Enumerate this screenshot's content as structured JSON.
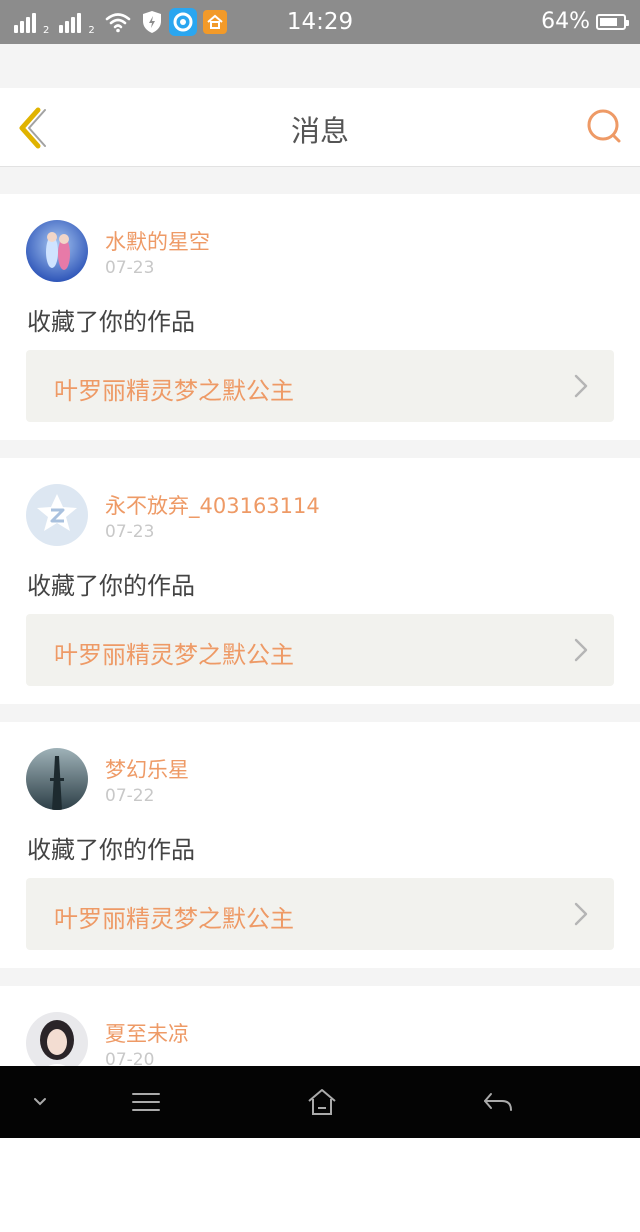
{
  "status_bar": {
    "time": "14:29",
    "battery": "64%",
    "battery_level": 0.64,
    "signal_sub_1": "2",
    "signal_sub_2": "2",
    "icons": [
      "signal-icon",
      "signal-icon",
      "wifi-icon",
      "shield-icon",
      "app-icon",
      "home-app-icon",
      "battery-icon"
    ]
  },
  "header": {
    "title": "消息",
    "back_icon": "chevron-left-icon",
    "search_icon": "search-icon"
  },
  "messages": [
    {
      "username": "水默的星空",
      "date": "07-23",
      "action": "收藏了你的作品",
      "work_title": "叶罗丽精灵梦之默公主"
    },
    {
      "username": "永不放弃_403163114",
      "date": "07-23",
      "action": "收藏了你的作品",
      "work_title": "叶罗丽精灵梦之默公主"
    },
    {
      "username": "梦幻乐星",
      "date": "07-22",
      "action": "收藏了你的作品",
      "work_title": "叶罗丽精灵梦之默公主"
    },
    {
      "username": "夏至未凉",
      "date": "07-20",
      "action": "",
      "work_title": ""
    }
  ],
  "colors": {
    "accent": "#ee9a66",
    "back_icon": "#e0b300",
    "status_bar": "#8c8c8c",
    "nav_bar": "#040404"
  },
  "nav_bar": {
    "icons": [
      "chevron-down-icon",
      "menu-icon",
      "home-icon",
      "back-icon"
    ]
  }
}
